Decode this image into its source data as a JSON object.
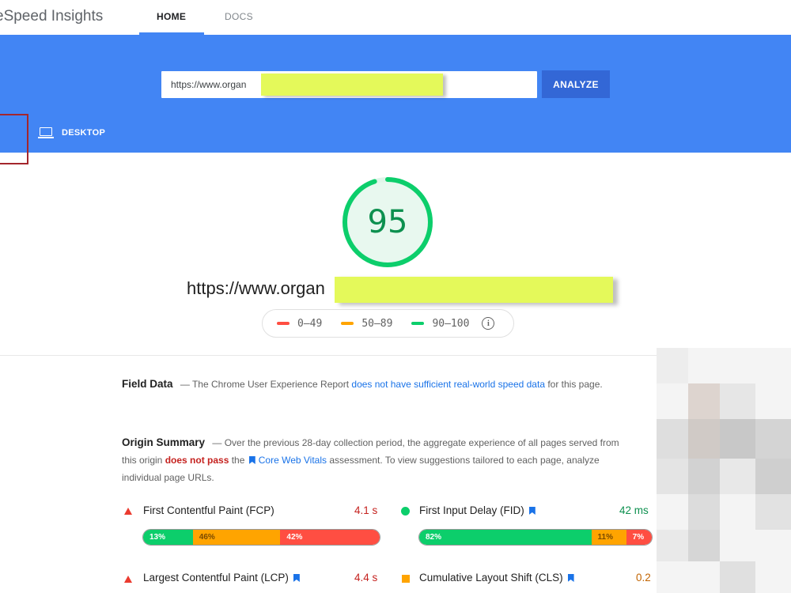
{
  "header": {
    "app_title": "eSpeed Insights",
    "tabs": [
      {
        "label": "HOME",
        "active": true
      },
      {
        "label": "DOCS",
        "active": false
      }
    ],
    "accent_color": "#4285f4"
  },
  "search": {
    "url_value": "https://www.organ",
    "analyze_label": "ANALYZE"
  },
  "device_tabs": {
    "desktop_label": "DESKTOP",
    "desktop_icon": "laptop-icon"
  },
  "result": {
    "score": "95",
    "score_fraction": 0.95,
    "score_color": "#0cce6b",
    "page_url": "https://www.organ"
  },
  "legend": {
    "items": [
      {
        "label": "0–49",
        "color": "#ff4e42"
      },
      {
        "label": "50–89",
        "color": "#ffa400"
      },
      {
        "label": "90–100",
        "color": "#0cce6b"
      }
    ],
    "info_icon": "info-icon"
  },
  "field_data": {
    "title": "Field Data",
    "text_before": " — The Chrome User Experience Report ",
    "link": "does not have sufficient real-world speed data",
    "text_after": " for this page."
  },
  "origin_summary": {
    "title": "Origin Summary",
    "text_1": " — Over the previous 28-day collection period, the aggregate experience of all pages served from this origin ",
    "fail_text": "does not pass",
    "text_2": " the ",
    "cwv_link": "Core Web Vitals",
    "text_3": " assessment. To view suggestions tailored to each page, analyze individual page URLs."
  },
  "metrics": [
    {
      "label": "First Contentful Paint (FCP)",
      "value": "4.1 s",
      "status": "fail",
      "segments": [
        {
          "pct": 13,
          "label": "13%"
        },
        {
          "pct": 46,
          "label": "46%"
        },
        {
          "pct": 42,
          "label": "42%"
        }
      ]
    },
    {
      "label": "First Input Delay (FID)",
      "value": "42 ms",
      "status": "pass",
      "segments": [
        {
          "pct": 82,
          "label": "82%"
        },
        {
          "pct": 11,
          "label": "11%"
        },
        {
          "pct": 7,
          "label": "7%"
        }
      ]
    },
    {
      "label": "Largest Contentful Paint (LCP)",
      "value": "4.4 s",
      "status": "fail"
    },
    {
      "label": "Cumulative Layout Shift (CLS)",
      "value": "0.2",
      "status": "average"
    }
  ]
}
